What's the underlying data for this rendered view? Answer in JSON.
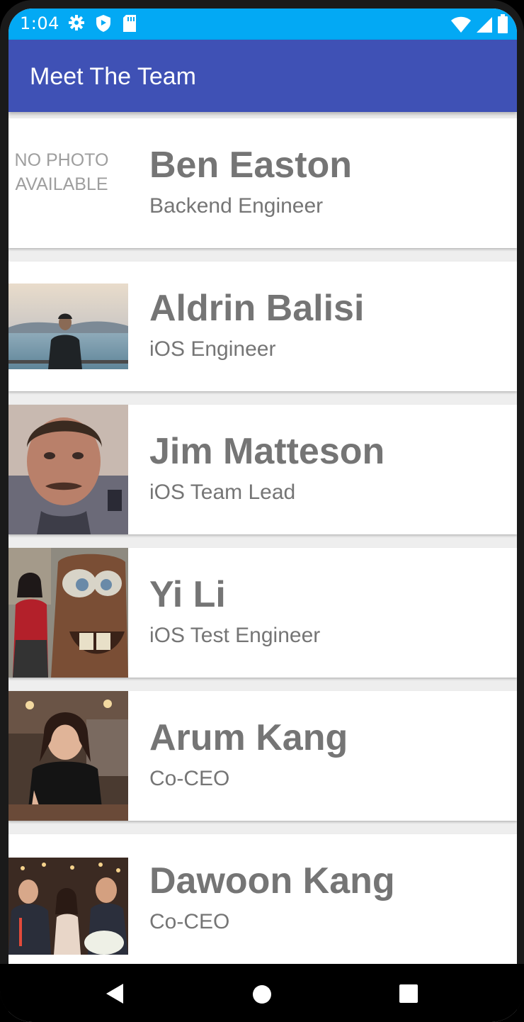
{
  "status_bar": {
    "time": "1:04",
    "icons_left": [
      "gear-icon",
      "shield-icon",
      "sd-card-icon"
    ],
    "icons_right": [
      "wifi-icon",
      "cell-signal-icon",
      "battery-icon"
    ]
  },
  "app_bar": {
    "title": "Meet The Team"
  },
  "no_photo_text": "NO PHOTO AVAILABLE",
  "team": [
    {
      "name": "Ben Easton",
      "title": "Backend Engineer",
      "photo": "none"
    },
    {
      "name": "Aldrin Balisi",
      "title": "iOS Engineer",
      "photo": "man-by-water"
    },
    {
      "name": "Jim Matteson",
      "title": "iOS Team Lead",
      "photo": "man-selfie"
    },
    {
      "name": "Yi Li",
      "title": "iOS Test Engineer",
      "photo": "woman-with-tow-truck-figure"
    },
    {
      "name": "Arum Kang",
      "title": "Co-CEO",
      "photo": "woman-restaurant"
    },
    {
      "name": "Dawoon Kang",
      "title": "Co-CEO",
      "photo": "group-dinner"
    }
  ],
  "colors": {
    "status_bar": "#03a9f4",
    "app_bar": "#3f51b5",
    "text_gray": "#757575"
  }
}
